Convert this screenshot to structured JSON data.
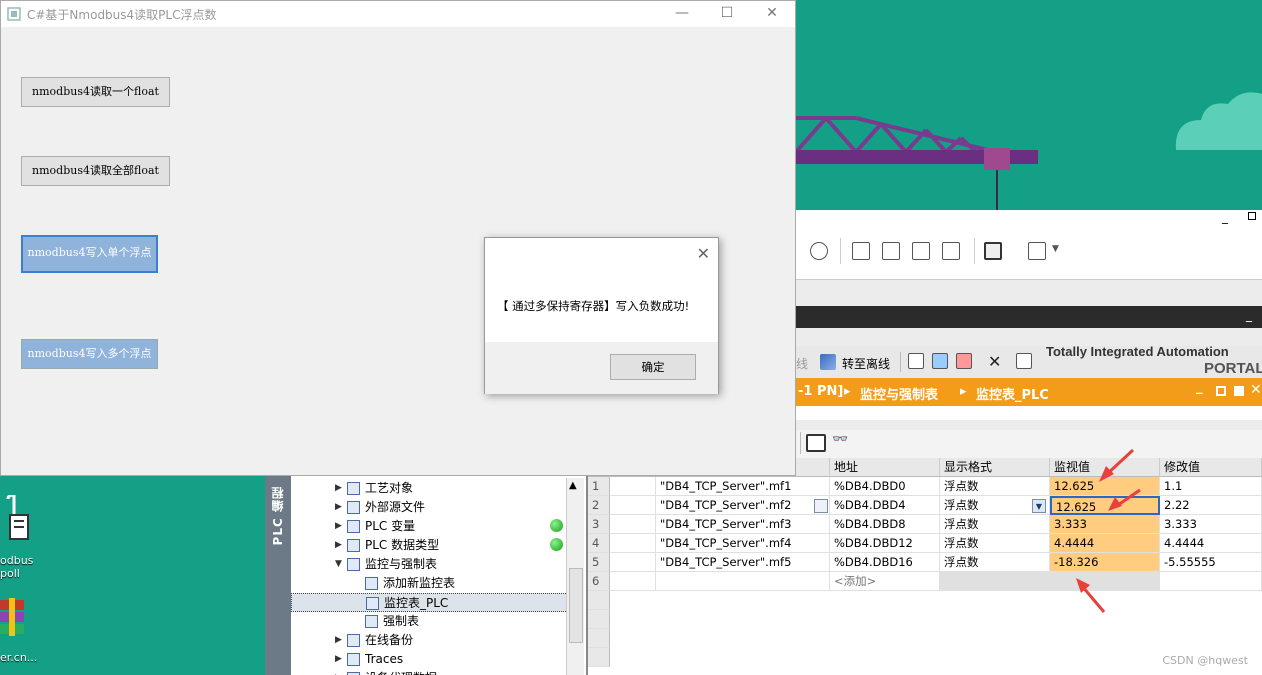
{
  "app": {
    "title": "C#基于Nmodbus4读取PLC浮点数",
    "buttons": [
      {
        "label": "nmodbus4读取一个float"
      },
      {
        "label": "nmodbus4读取全部float"
      },
      {
        "label": "nmodbus4写入单个浮点"
      },
      {
        "label": "nmodbus4写入多个浮点"
      }
    ],
    "window_controls": {
      "minimize": "—",
      "maximize": "☐",
      "close": "✕"
    }
  },
  "msgbox": {
    "message": "【 通过多保持寄存器】写入负数成功!",
    "ok_label": "确定",
    "close": "✕"
  },
  "desktop": {
    "icon1_label": "odbus\npoll",
    "icon2_label": "er.cn..."
  },
  "tia": {
    "toolbar_go_offline": "转至离线",
    "partial_online": "线",
    "brand_title": "Totally Integrated Automation",
    "brand_sub": "PORTAL",
    "breadcrumb": {
      "part1": "-1 PN]",
      "sep": "▸",
      "part2": "监控与强制表",
      "part3": "监控表_PLC"
    },
    "tree_title": "PLC 编程",
    "tree": [
      {
        "label": "工艺对象",
        "arrow": "▶"
      },
      {
        "label": "外部源文件",
        "arrow": "▶"
      },
      {
        "label": "PLC 变量",
        "arrow": "▶"
      },
      {
        "label": "PLC 数据类型",
        "arrow": "▶"
      },
      {
        "label": "监控与强制表",
        "arrow": "▼"
      },
      {
        "label": "添加新监控表",
        "arrow": ""
      },
      {
        "label": "监控表_PLC",
        "arrow": ""
      },
      {
        "label": "强制表",
        "arrow": ""
      },
      {
        "label": "在线备份",
        "arrow": "▶"
      },
      {
        "label": "Traces",
        "arrow": "▶"
      },
      {
        "label": "设备代理数据",
        "arrow": "▶"
      }
    ],
    "table": {
      "headers": [
        "地址",
        "显示格式",
        "监视值",
        "修改值"
      ],
      "rows": [
        {
          "n": "1",
          "name": "\"DB4_TCP_Server\".mf1",
          "addr": "%DB4.DBD0",
          "fmt": "浮点数",
          "monitor": "12.625",
          "modify": "1.1"
        },
        {
          "n": "2",
          "name": "\"DB4_TCP_Server\".mf2",
          "addr": "%DB4.DBD4",
          "fmt": "浮点数",
          "monitor": "12.625",
          "modify": "2.22"
        },
        {
          "n": "3",
          "name": "\"DB4_TCP_Server\".mf3",
          "addr": "%DB4.DBD8",
          "fmt": "浮点数",
          "monitor": "3.333",
          "modify": "3.333"
        },
        {
          "n": "4",
          "name": "\"DB4_TCP_Server\".mf4",
          "addr": "%DB4.DBD12",
          "fmt": "浮点数",
          "monitor": "4.4444",
          "modify": "4.4444"
        },
        {
          "n": "5",
          "name": "\"DB4_TCP_Server\".mf5",
          "addr": "%DB4.DBD16",
          "fmt": "浮点数",
          "monitor": "-18.326",
          "modify": "-5.55555"
        },
        {
          "n": "6",
          "name": "",
          "addr": "<添加>",
          "fmt": "",
          "monitor": "",
          "modify": ""
        }
      ]
    }
  },
  "watermark": "CSDN @hqwest",
  "colors": {
    "desktop": "#13a087",
    "orange_bar": "#f39c1a",
    "monitor_cell": "#ffcc80",
    "crane": "#7a3b8f",
    "annotation_arrow": "#e8403a"
  }
}
